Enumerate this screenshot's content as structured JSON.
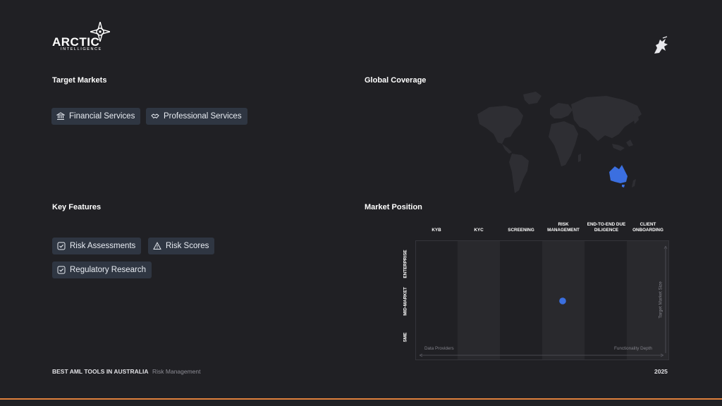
{
  "brand": {
    "logo_text": "ARCTIC",
    "logo_subtext": "INTELLIGENCE",
    "accent_color": "#e0803c"
  },
  "target_markets": {
    "title": "Target Markets",
    "items": [
      {
        "label": "Financial Services",
        "icon": "bank-icon"
      },
      {
        "label": "Professional Services",
        "icon": "handshake-icon"
      }
    ]
  },
  "global_coverage": {
    "title": "Global Coverage",
    "highlighted_region": "Australia",
    "highlight_color": "#3b6fe0"
  },
  "key_features": {
    "title": "Key Features",
    "items": [
      {
        "label": "Risk Assessments",
        "icon": "checkbox-icon"
      },
      {
        "label": "Risk Scores",
        "icon": "warning-icon"
      },
      {
        "label": "Regulatory Research",
        "icon": "checkbox-icon"
      }
    ]
  },
  "market_position": {
    "title": "Market Position",
    "columns": [
      "KYB",
      "KYC",
      "SCREENING",
      "RISK MANAGEMENT",
      "END-TO-END DUE DILIGENCE",
      "CLIENT ONBOARDING"
    ],
    "rows": [
      "ENTERPRISE",
      "MID-MARKET",
      "SME"
    ],
    "x_axis_start": "Data Providers",
    "x_axis_end": "Functionality Depth",
    "y_axis": "Target Market Size",
    "position": {
      "column": "RISK MANAGEMENT",
      "row": "MID-MARKET"
    },
    "dot_color": "#3b6fe0"
  },
  "footer": {
    "title": "BEST AML TOOLS IN AUSTRALIA",
    "category": "Risk Management",
    "year": "2025"
  }
}
